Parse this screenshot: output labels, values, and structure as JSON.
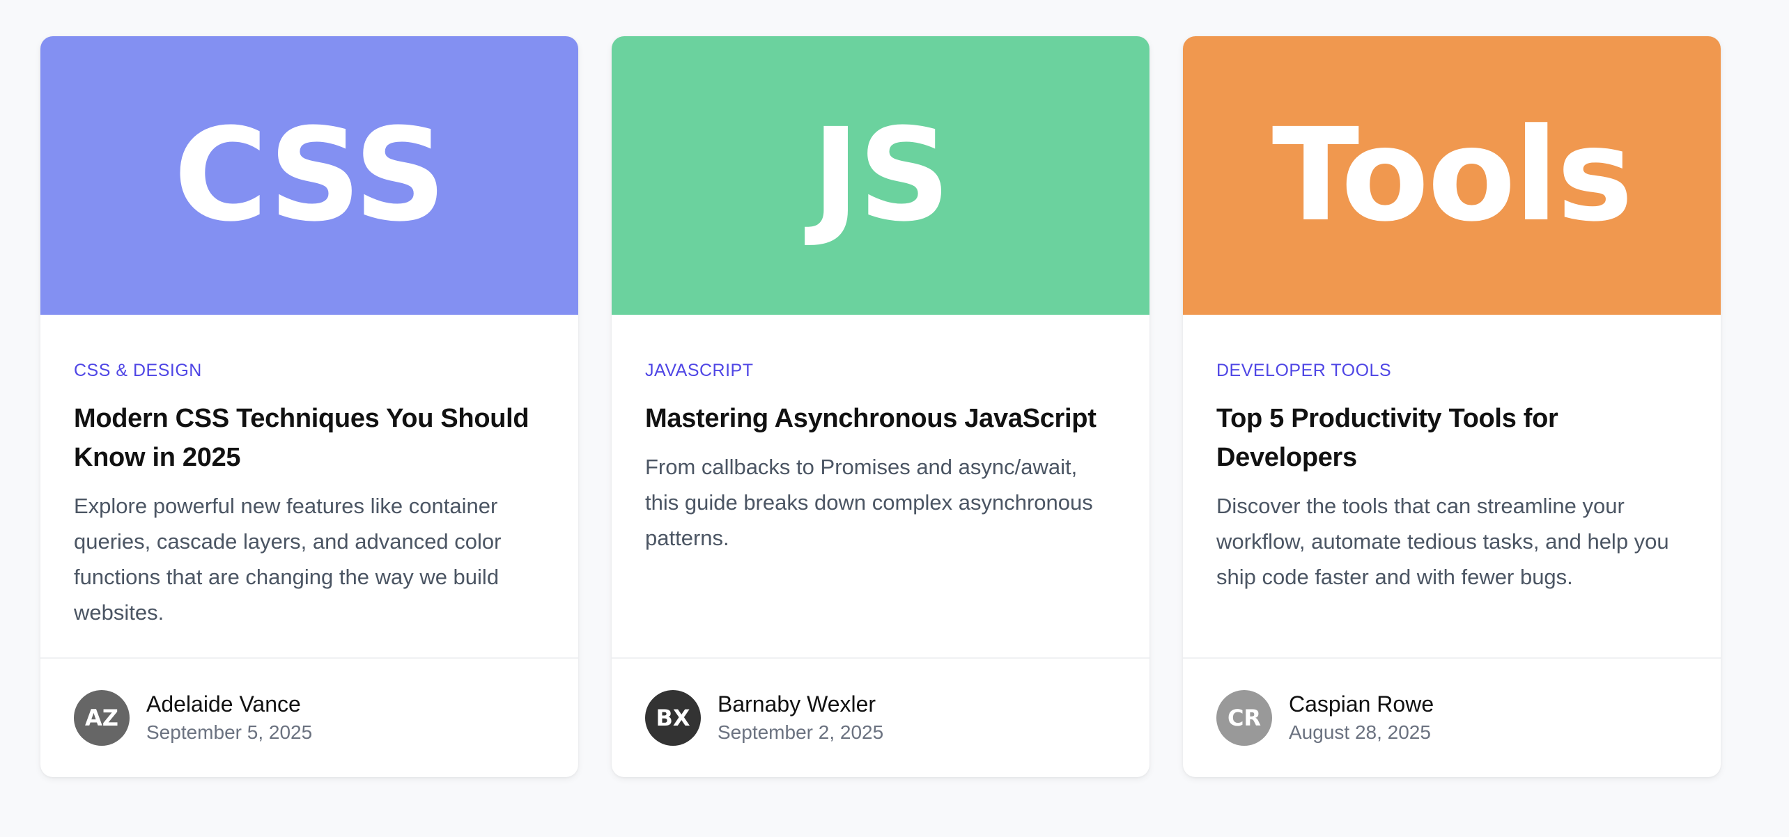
{
  "cards": [
    {
      "hero_text": "CSS",
      "hero_color": "#8390f2",
      "category": "CSS & DESIGN",
      "title": "Modern CSS Techniques You Should Know in 2025",
      "excerpt": "Explore powerful new features like container queries, cascade layers, and advanced color functions that are changing the way we build websites.",
      "author": {
        "initials": "AZ",
        "avatar_color": "#666666",
        "name": "Adelaide Vance",
        "date": "September 5, 2025"
      }
    },
    {
      "hero_text": "JS",
      "hero_color": "#6bd29e",
      "category": "JAVASCRIPT",
      "title": "Mastering Asynchronous JavaScript",
      "excerpt": "From callbacks to Promises and async/await, this guide breaks down complex asynchronous patterns.",
      "author": {
        "initials": "BX",
        "avatar_color": "#333333",
        "name": "Barnaby Wexler",
        "date": "September 2, 2025"
      }
    },
    {
      "hero_text": "Tools",
      "hero_color": "#f0984f",
      "category": "DEVELOPER TOOLS",
      "title": "Top 5 Productivity Tools for Developers",
      "excerpt": "Discover the tools that can streamline your workflow, automate tedious tasks, and help you ship code faster and with fewer bugs.",
      "author": {
        "initials": "CR",
        "avatar_color": "#999999",
        "name": "Caspian Rowe",
        "date": "August 28, 2025"
      }
    }
  ]
}
